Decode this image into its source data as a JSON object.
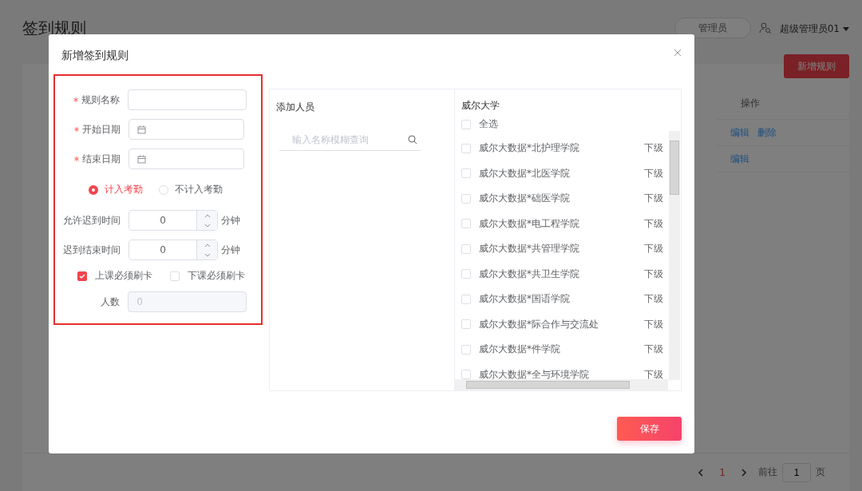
{
  "page": {
    "title": "签到规则",
    "admin_button": "管理员",
    "user_name": "超级管理员01",
    "add_button": "新增规则",
    "table": {
      "columns": [
        {
          "label": "操作"
        }
      ],
      "rows": [
        {
          "actions": [
            "编辑",
            "删除"
          ]
        },
        {
          "actions": [
            "编辑"
          ]
        }
      ]
    },
    "pagination": {
      "current": "1",
      "goto_label": "前往",
      "goto_value": "1",
      "page_unit": "页"
    }
  },
  "dialog": {
    "title": "新增签到规则",
    "fields": [
      {
        "kind": "text",
        "label": "规则名称",
        "required": true
      },
      {
        "kind": "date",
        "label": "开始日期",
        "required": true
      },
      {
        "kind": "date",
        "label": "结束日期",
        "required": true
      }
    ],
    "attendance": [
      {
        "label": "计入考勤",
        "selected": true
      },
      {
        "label": "不计入考勤",
        "selected": false
      }
    ],
    "numbers": [
      {
        "label": "允许迟到时间",
        "value": "0",
        "unit": "分钟"
      },
      {
        "label": "迟到结束时间",
        "value": "0",
        "unit": "分钟"
      }
    ],
    "checks": [
      {
        "label": "上课必须刷卡",
        "checked": true
      },
      {
        "label": "下课必须刷卡",
        "checked": false
      }
    ],
    "count": {
      "label": "人数",
      "value": "0",
      "disabled": true
    },
    "transfer": {
      "left_title": "添加人员",
      "search_placeholder": "输入名称模糊查询",
      "right_title": "威尔大学",
      "select_all": {
        "label": "全选",
        "checked": false
      },
      "items": [
        {
          "name": "威尔大数据*北护理学院",
          "action": "下级",
          "checked": false
        },
        {
          "name": "威尔大数据*北医学院",
          "action": "下级",
          "checked": false
        },
        {
          "name": "威尔大数据*础医学院",
          "action": "下级",
          "checked": false
        },
        {
          "name": "威尔大数据*电工程学院",
          "action": "下级",
          "checked": false
        },
        {
          "name": "威尔大数据*共管理学院",
          "action": "下级",
          "checked": false
        },
        {
          "name": "威尔大数据*共卫生学院",
          "action": "下级",
          "checked": false
        },
        {
          "name": "威尔大数据*国语学院",
          "action": "下级",
          "checked": false
        },
        {
          "name": "威尔大数据*际合作与交流处",
          "action": "下级",
          "checked": false
        },
        {
          "name": "威尔大数据*件学院",
          "action": "下级",
          "checked": false
        },
        {
          "name": "威尔大数据*全与环境学院",
          "action": "下级",
          "checked": false
        }
      ]
    },
    "save_button": "保存"
  }
}
